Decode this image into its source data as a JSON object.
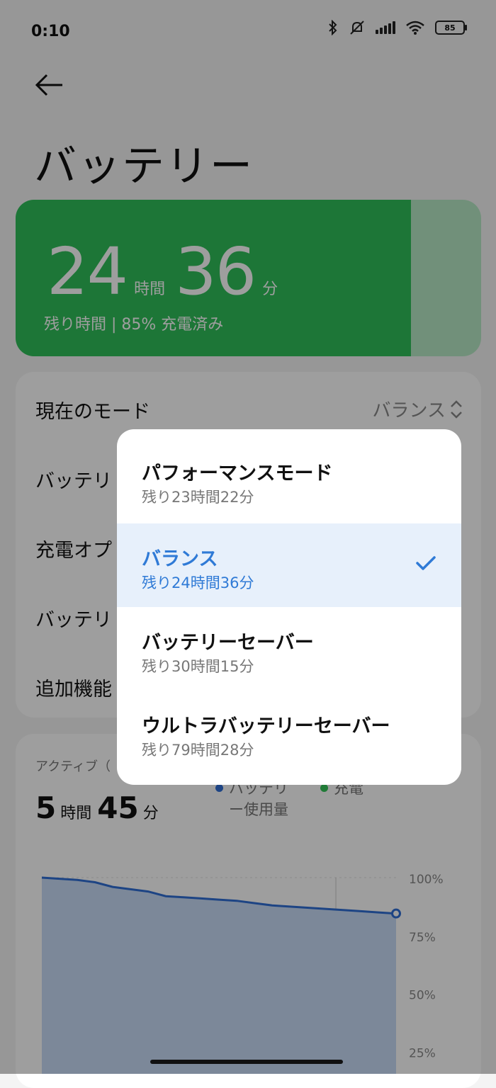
{
  "status_bar": {
    "time": "0:10",
    "battery_level": "85"
  },
  "header": {
    "title": "バッテリー"
  },
  "battery": {
    "hours": "24",
    "hours_unit": "時間",
    "minutes": "36",
    "minutes_unit": "分",
    "subtitle": "残り時間 | 85% 充電済み",
    "level_percent": 85,
    "fill_color": "#2fbf59"
  },
  "settings": {
    "current_mode_label": "現在のモード",
    "current_mode_value": "バランス",
    "rows": [
      "バッテリ",
      "充電オプ",
      "バッテリ",
      "追加機能"
    ]
  },
  "usage": {
    "label": "アクティブ（",
    "hours": "5",
    "hours_unit": "時間",
    "minutes": "45",
    "minutes_unit": "分",
    "legend": [
      {
        "label_line1": "バッテリ",
        "label_line2": "ー使用量",
        "color": "#2f6fd6"
      },
      {
        "label_line1": "充電",
        "label_line2": "",
        "color": "#34c759"
      }
    ]
  },
  "chart_data": {
    "type": "area",
    "y_ticks": [
      "100%",
      "75%",
      "50%",
      "25%"
    ],
    "ylim": [
      0,
      100
    ],
    "series": [
      {
        "values": [
          100,
          99.5,
          99,
          98,
          96,
          95,
          94,
          92,
          91.5,
          91,
          90.5,
          90,
          89,
          88,
          87.5,
          87,
          86.5,
          86,
          85.5,
          85,
          84.5
        ]
      }
    ],
    "line_color": "#2f6fd6"
  },
  "dropdown": {
    "options": [
      {
        "title": "パフォーマンスモード",
        "subtitle": "残り23時間22分",
        "selected": false
      },
      {
        "title": "バランス",
        "subtitle": "残り24時間36分",
        "selected": true
      },
      {
        "title": "バッテリーセーバー",
        "subtitle": "残り30時間15分",
        "selected": false
      },
      {
        "title": "ウルトラバッテリーセーバー",
        "subtitle": "残り79時間28分",
        "selected": false
      }
    ]
  }
}
